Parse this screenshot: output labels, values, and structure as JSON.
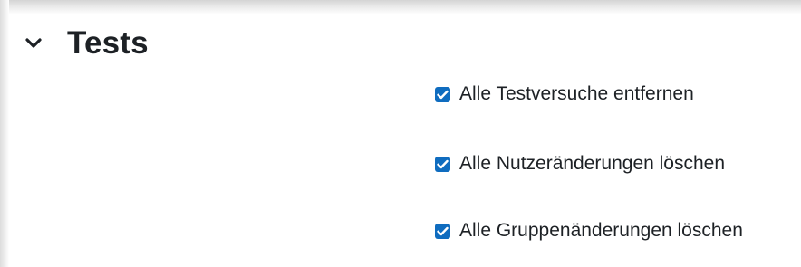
{
  "section": {
    "title": "Tests",
    "expanded": true,
    "toggle_icon": "chevron-down-icon"
  },
  "options": [
    {
      "label": "Alle Testversuche entfernen",
      "checked": true
    },
    {
      "label": "Alle Nutzeränderungen löschen",
      "checked": true
    },
    {
      "label": "Alle Gruppenänderungen löschen",
      "checked": true
    }
  ],
  "colors": {
    "checkbox_accent": "#0f6cbf",
    "text": "#1d2125"
  }
}
